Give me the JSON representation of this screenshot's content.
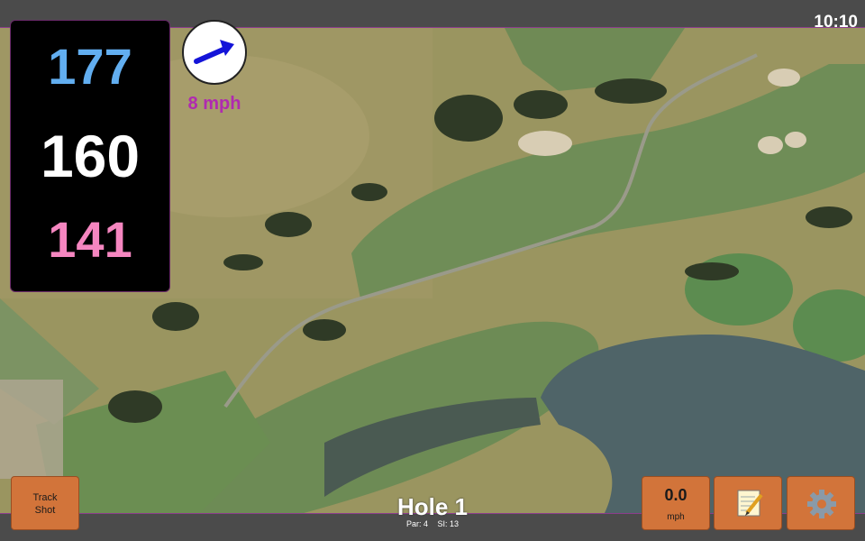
{
  "status_bar": {
    "time": "10:10"
  },
  "distances": {
    "back": "177",
    "middle": "160",
    "front": "141"
  },
  "wind": {
    "speed_label": "8 mph",
    "arrow_icon": "wind-direction-arrow-icon"
  },
  "buttons": {
    "track_shot_line1": "Track",
    "track_shot_line2": "Shot",
    "speed_value": "0.0",
    "speed_unit": "mph",
    "notes_icon": "notepad-icon",
    "settings_icon": "gear-icon"
  },
  "hole": {
    "title": "Hole 1",
    "par": "Par: 4",
    "si": "SI: 13"
  },
  "colors": {
    "back": "#62aef0",
    "middle": "#ffffff",
    "front": "#f586c0",
    "button": "#d2743a",
    "wind_text": "#b02ab0"
  }
}
